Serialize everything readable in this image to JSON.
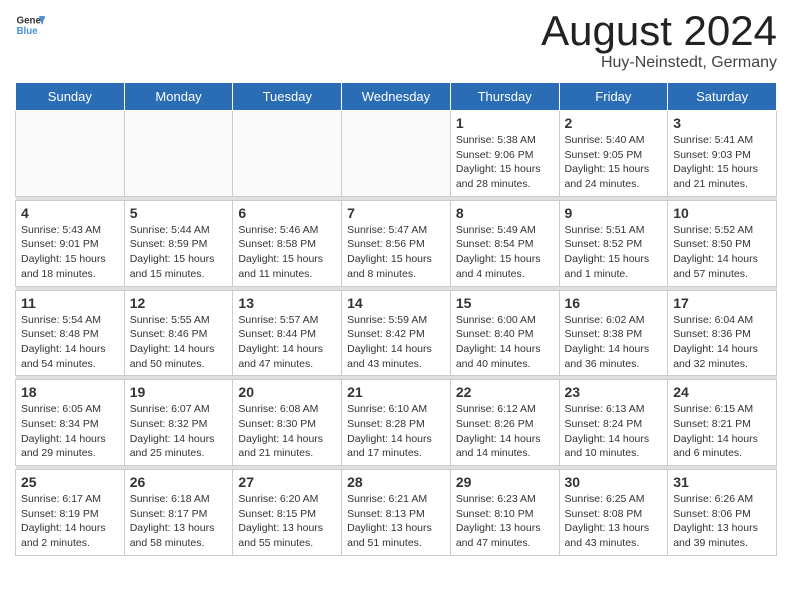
{
  "header": {
    "logo_line1": "General",
    "logo_line2": "Blue",
    "month": "August 2024",
    "location": "Huy-Neinstedt, Germany"
  },
  "days_of_week": [
    "Sunday",
    "Monday",
    "Tuesday",
    "Wednesday",
    "Thursday",
    "Friday",
    "Saturday"
  ],
  "weeks": [
    [
      {
        "day": "",
        "info": ""
      },
      {
        "day": "",
        "info": ""
      },
      {
        "day": "",
        "info": ""
      },
      {
        "day": "",
        "info": ""
      },
      {
        "day": "1",
        "info": "Sunrise: 5:38 AM\nSunset: 9:06 PM\nDaylight: 15 hours\nand 28 minutes."
      },
      {
        "day": "2",
        "info": "Sunrise: 5:40 AM\nSunset: 9:05 PM\nDaylight: 15 hours\nand 24 minutes."
      },
      {
        "day": "3",
        "info": "Sunrise: 5:41 AM\nSunset: 9:03 PM\nDaylight: 15 hours\nand 21 minutes."
      }
    ],
    [
      {
        "day": "4",
        "info": "Sunrise: 5:43 AM\nSunset: 9:01 PM\nDaylight: 15 hours\nand 18 minutes."
      },
      {
        "day": "5",
        "info": "Sunrise: 5:44 AM\nSunset: 8:59 PM\nDaylight: 15 hours\nand 15 minutes."
      },
      {
        "day": "6",
        "info": "Sunrise: 5:46 AM\nSunset: 8:58 PM\nDaylight: 15 hours\nand 11 minutes."
      },
      {
        "day": "7",
        "info": "Sunrise: 5:47 AM\nSunset: 8:56 PM\nDaylight: 15 hours\nand 8 minutes."
      },
      {
        "day": "8",
        "info": "Sunrise: 5:49 AM\nSunset: 8:54 PM\nDaylight: 15 hours\nand 4 minutes."
      },
      {
        "day": "9",
        "info": "Sunrise: 5:51 AM\nSunset: 8:52 PM\nDaylight: 15 hours\nand 1 minute."
      },
      {
        "day": "10",
        "info": "Sunrise: 5:52 AM\nSunset: 8:50 PM\nDaylight: 14 hours\nand 57 minutes."
      }
    ],
    [
      {
        "day": "11",
        "info": "Sunrise: 5:54 AM\nSunset: 8:48 PM\nDaylight: 14 hours\nand 54 minutes."
      },
      {
        "day": "12",
        "info": "Sunrise: 5:55 AM\nSunset: 8:46 PM\nDaylight: 14 hours\nand 50 minutes."
      },
      {
        "day": "13",
        "info": "Sunrise: 5:57 AM\nSunset: 8:44 PM\nDaylight: 14 hours\nand 47 minutes."
      },
      {
        "day": "14",
        "info": "Sunrise: 5:59 AM\nSunset: 8:42 PM\nDaylight: 14 hours\nand 43 minutes."
      },
      {
        "day": "15",
        "info": "Sunrise: 6:00 AM\nSunset: 8:40 PM\nDaylight: 14 hours\nand 40 minutes."
      },
      {
        "day": "16",
        "info": "Sunrise: 6:02 AM\nSunset: 8:38 PM\nDaylight: 14 hours\nand 36 minutes."
      },
      {
        "day": "17",
        "info": "Sunrise: 6:04 AM\nSunset: 8:36 PM\nDaylight: 14 hours\nand 32 minutes."
      }
    ],
    [
      {
        "day": "18",
        "info": "Sunrise: 6:05 AM\nSunset: 8:34 PM\nDaylight: 14 hours\nand 29 minutes."
      },
      {
        "day": "19",
        "info": "Sunrise: 6:07 AM\nSunset: 8:32 PM\nDaylight: 14 hours\nand 25 minutes."
      },
      {
        "day": "20",
        "info": "Sunrise: 6:08 AM\nSunset: 8:30 PM\nDaylight: 14 hours\nand 21 minutes."
      },
      {
        "day": "21",
        "info": "Sunrise: 6:10 AM\nSunset: 8:28 PM\nDaylight: 14 hours\nand 17 minutes."
      },
      {
        "day": "22",
        "info": "Sunrise: 6:12 AM\nSunset: 8:26 PM\nDaylight: 14 hours\nand 14 minutes."
      },
      {
        "day": "23",
        "info": "Sunrise: 6:13 AM\nSunset: 8:24 PM\nDaylight: 14 hours\nand 10 minutes."
      },
      {
        "day": "24",
        "info": "Sunrise: 6:15 AM\nSunset: 8:21 PM\nDaylight: 14 hours\nand 6 minutes."
      }
    ],
    [
      {
        "day": "25",
        "info": "Sunrise: 6:17 AM\nSunset: 8:19 PM\nDaylight: 14 hours\nand 2 minutes."
      },
      {
        "day": "26",
        "info": "Sunrise: 6:18 AM\nSunset: 8:17 PM\nDaylight: 13 hours\nand 58 minutes."
      },
      {
        "day": "27",
        "info": "Sunrise: 6:20 AM\nSunset: 8:15 PM\nDaylight: 13 hours\nand 55 minutes."
      },
      {
        "day": "28",
        "info": "Sunrise: 6:21 AM\nSunset: 8:13 PM\nDaylight: 13 hours\nand 51 minutes."
      },
      {
        "day": "29",
        "info": "Sunrise: 6:23 AM\nSunset: 8:10 PM\nDaylight: 13 hours\nand 47 minutes."
      },
      {
        "day": "30",
        "info": "Sunrise: 6:25 AM\nSunset: 8:08 PM\nDaylight: 13 hours\nand 43 minutes."
      },
      {
        "day": "31",
        "info": "Sunrise: 6:26 AM\nSunset: 8:06 PM\nDaylight: 13 hours\nand 39 minutes."
      }
    ]
  ]
}
